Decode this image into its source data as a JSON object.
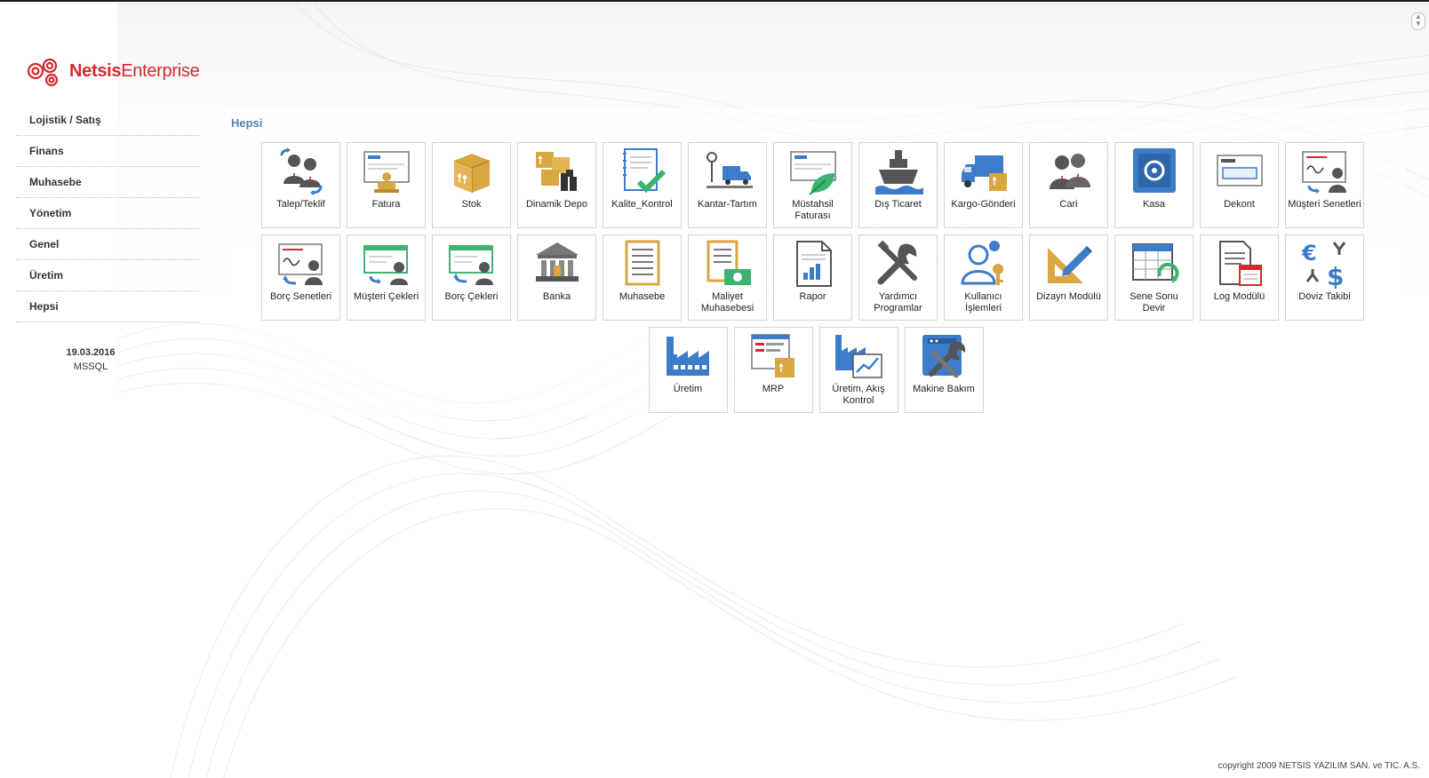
{
  "logo": {
    "brand": "Netsis",
    "product": "Enterprise"
  },
  "sidebar": {
    "items": [
      {
        "label": "Lojistik / Satış"
      },
      {
        "label": "Finans"
      },
      {
        "label": "Muhasebe"
      },
      {
        "label": "Yönetim"
      },
      {
        "label": "Genel"
      },
      {
        "label": "Üretim"
      },
      {
        "label": "Hepsi"
      }
    ]
  },
  "meta": {
    "date": "19.03.2016",
    "db": "MSSQL"
  },
  "section": {
    "title": "Hepsi"
  },
  "tiles": {
    "row1": [
      {
        "label": "Talep/Teklif",
        "icon": "people-exchange-icon"
      },
      {
        "label": "Fatura",
        "icon": "invoice-icon"
      },
      {
        "label": "Stok",
        "icon": "box-icon"
      },
      {
        "label": "Dinamik Depo",
        "icon": "warehouse-boxes-icon"
      },
      {
        "label": "Kalite_Kontrol",
        "icon": "checklist-icon"
      },
      {
        "label": "Kantar-Tartım",
        "icon": "truck-scale-icon"
      },
      {
        "label": "Müstahsil Faturası",
        "icon": "leaf-invoice-icon"
      },
      {
        "label": "Dış Ticaret",
        "icon": "ship-icon"
      },
      {
        "label": "Kargo-Gönderi",
        "icon": "cargo-truck-icon"
      },
      {
        "label": "Cari",
        "icon": "people-icon"
      },
      {
        "label": "Kasa",
        "icon": "safe-icon"
      },
      {
        "label": "Dekont",
        "icon": "receipt-icon"
      },
      {
        "label": "Müşteri Senetleri",
        "icon": "promissory-note-icon"
      }
    ],
    "row2": [
      {
        "label": "Borç Senetleri",
        "icon": "debt-note-icon"
      },
      {
        "label": "Müşteri Çekleri",
        "icon": "customer-check-icon"
      },
      {
        "label": "Borç Çekleri",
        "icon": "debt-check-icon"
      },
      {
        "label": "Banka",
        "icon": "bank-icon"
      },
      {
        "label": "Muhasebe",
        "icon": "ledger-icon"
      },
      {
        "label": "Maliyet Muhasebesi",
        "icon": "cost-ledger-icon"
      },
      {
        "label": "Rapor",
        "icon": "report-icon"
      },
      {
        "label": "Yardımcı Programlar",
        "icon": "tools-icon"
      },
      {
        "label": "Kullanıcı İşlemleri",
        "icon": "user-key-icon"
      },
      {
        "label": "Dizayn Modülü",
        "icon": "design-pencil-icon"
      },
      {
        "label": "Sene Sonu Devir",
        "icon": "calendar-refresh-icon"
      },
      {
        "label": "Log Modülü",
        "icon": "log-document-icon"
      },
      {
        "label": "Döviz Takibi",
        "icon": "currency-exchange-icon"
      }
    ],
    "row3": [
      {
        "label": "Üretim",
        "icon": "factory-icon"
      },
      {
        "label": "MRP",
        "icon": "mrp-icon"
      },
      {
        "label": "Üretim, Akış Kontrol",
        "icon": "factory-chart-icon"
      },
      {
        "label": "Makine Bakım",
        "icon": "machine-maintenance-icon"
      }
    ]
  },
  "footer": {
    "copyright": "copyright 2009 NETSIS YAZILIM SAN. ve TIC. A.S."
  },
  "colors": {
    "brand_red": "#d8262e",
    "icon_blue": "#3d7cc9",
    "icon_gold": "#d9a640",
    "icon_green": "#3cb371",
    "icon_grey": "#555555",
    "section_title": "#5a7eb0"
  }
}
